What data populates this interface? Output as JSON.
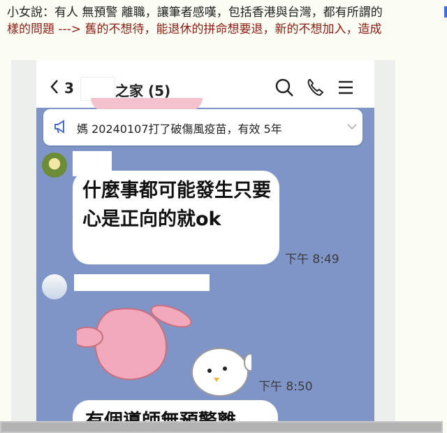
{
  "article": {
    "line1": "小女說：有人 無預警 離職，讓筆者感嘆，包括香港與台灣，都有所謂的",
    "line2": "樣的問題 ---> 舊的不想待，能退休的拼命想要退，新的不想加入，造成"
  },
  "chat": {
    "back_count": "3",
    "title": "之家 (5)",
    "notice_text": "媽 20240107打了破傷風疫苗，有效 5年",
    "message1": "什麼事都可能發生只要心是正向的就ok",
    "time1": "下午 8:49",
    "time2": "下午 8:50",
    "message2_partial": "有個導師無預警離"
  },
  "icons": [
    "back-chevron-icon",
    "search-icon",
    "phone-icon",
    "menu-icon",
    "megaphone-icon",
    "chevron-down-icon"
  ],
  "colors": {
    "chat_bg": "#7f95c7",
    "article_accent": "#8b1d12"
  }
}
